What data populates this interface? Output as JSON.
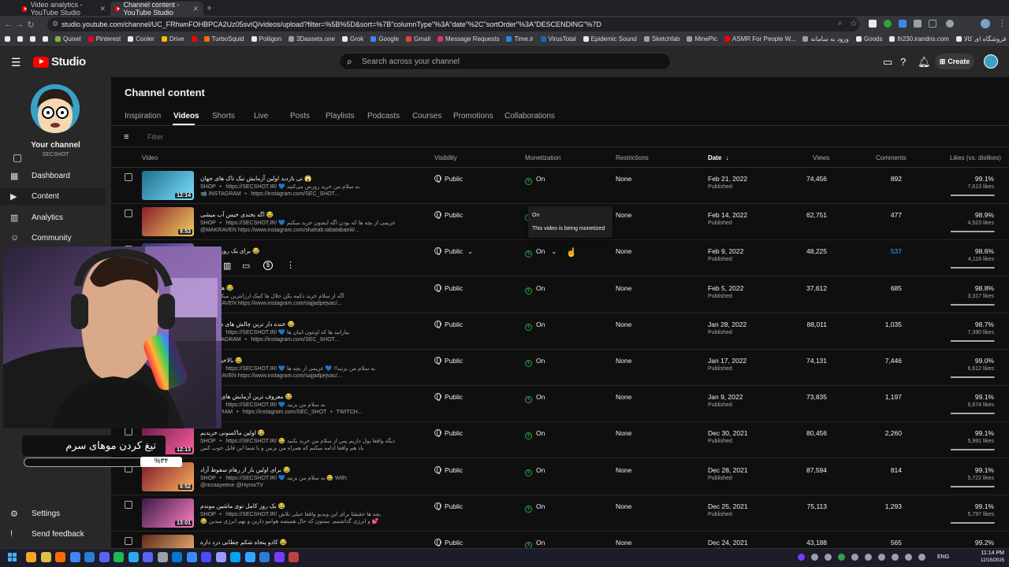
{
  "browser": {
    "tabs": [
      {
        "label": "Video analytics - YouTube Studio"
      },
      {
        "label": "Channel content - YouTube Studio"
      }
    ],
    "url": "studio.youtube.com/channel/UC_FRhwnFOHBPCA2Uz05svIQ/videos/upload?filter=%5B%5D&sort=%7B\"columnType\"%3A\"date\"%2C\"sortOrder\"%3A\"DESCENDING\"%7D",
    "bookmarks": [
      {
        "label": "",
        "color": "#e8eaed"
      },
      {
        "label": "",
        "color": "#e8eaed"
      },
      {
        "label": "",
        "color": "#e8eaed"
      },
      {
        "label": "",
        "color": "#e8eaed"
      },
      {
        "label": "Quixel",
        "color": "#7cb342"
      },
      {
        "label": "Pinterest",
        "color": "#e60023"
      },
      {
        "label": "Cooler",
        "color": "#e8eaed"
      },
      {
        "label": "Drive",
        "color": "#fbbc04"
      },
      {
        "label": "",
        "color": "#ff0000"
      },
      {
        "label": "TurboSquid",
        "color": "#ff6d00"
      },
      {
        "label": "Poliigon",
        "color": "#e8eaed"
      },
      {
        "label": "3Dassets.one",
        "color": "#9aa0a6"
      },
      {
        "label": "Grok",
        "color": "#e8eaed"
      },
      {
        "label": "Google",
        "color": "#4285f4"
      },
      {
        "label": "Gmail",
        "color": "#ea4335"
      },
      {
        "label": "Message Requests",
        "color": "#e1306c"
      },
      {
        "label": "Time.ir",
        "color": "#1e88e5"
      },
      {
        "label": "VirusTotal",
        "color": "#1565c0"
      },
      {
        "label": "Epidemic Sound",
        "color": "#e8eaed"
      },
      {
        "label": "Sketchfab",
        "color": "#9aa0a6"
      },
      {
        "label": "MinePic",
        "color": "#9aa0a6"
      },
      {
        "label": "ASMR For People W...",
        "color": "#ff0000"
      },
      {
        "label": "ورود به سامانه",
        "color": "#9aa0a6"
      },
      {
        "label": "Goods",
        "color": "#e8eaed"
      },
      {
        "label": "lh230.irandns.com",
        "color": "#e8eaed"
      },
      {
        "label": "فروشگاه ای کالا",
        "color": "#e8eaed"
      },
      {
        "label": "Other",
        "color": "#9aa0a6"
      },
      {
        "label": "All Bookmarks",
        "color": "#9aa0a6"
      }
    ]
  },
  "header": {
    "logo": "Studio",
    "search_placeholder": "Search across your channel",
    "create_label": "Create"
  },
  "sidebar": {
    "channel_title": "Your channel",
    "channel_name": "SECSHOT",
    "items": [
      {
        "label": "Dashboard",
        "icon": "dashboard-icon"
      },
      {
        "label": "Content",
        "icon": "content-icon"
      },
      {
        "label": "Analytics",
        "icon": "analytics-icon"
      },
      {
        "label": "Community",
        "icon": "community-icon"
      }
    ],
    "settings": "Settings",
    "feedback": "Send feedback"
  },
  "main": {
    "title": "Channel content",
    "tabs": [
      "Inspiration",
      "Videos",
      "Shorts",
      "Live",
      "Posts",
      "Playlists",
      "Podcasts",
      "Courses",
      "Promotions",
      "Collaborations"
    ],
    "filter_placeholder": "Filter",
    "columns": {
      "video": "Video",
      "visibility": "Visibility",
      "monetization": "Monetization",
      "restrictions": "Restrictions",
      "date": "Date",
      "views": "Views",
      "comments": "Comments",
      "likes": "Likes (vs. dislikes)"
    }
  },
  "tooltip": {
    "title": "On",
    "text": "This video is being monetized"
  },
  "rows": [
    {
      "title": "تی بازدید اولین آزمایش تیک تاک های جهان 😱",
      "desc1": "SHOP 🔹 https://SECSHOT.IR/ 💙 به سلام من خرید روزش می‌کنید",
      "desc2": "📹 INSTAGRAM 🔹 https://instagram.com/SEC_SHOT...",
      "duration": "12:14",
      "visibility": "Public",
      "monetization": "On",
      "restrictions": "None",
      "date": "Feb 21, 2022",
      "status": "Published",
      "views": "74,456",
      "comments": "892",
      "likes_pct": "99.1%",
      "likes": "7,613 likes",
      "ratio": 0.991
    },
    {
      "title": "اگه بخندی خیس آب میشی 😂",
      "desc1": "SHOP 🔹 https://SECSHOT.IR/ 💙 عزیمی از بچه ها که بودن اگه ایشون خرید میکنم",
      "desc2": "@MAKRAVEN https://www.instagram.com/shahab.tabatabaeiii/...",
      "duration": "9:53",
      "visibility": "Public",
      "monetization": "On",
      "restrictions": "None",
      "date": "Feb 14, 2022",
      "status": "Published",
      "views": "62,751",
      "comments": "477",
      "likes_pct": "98.9%",
      "likes": "4,523 likes",
      "ratio": 0.989
    },
    {
      "title": "برای یک روز کامل ها 😂",
      "desc1": "",
      "desc2": "",
      "duration": "",
      "visibility": "Public",
      "monetization": "On",
      "restrictions": "None",
      "date": "Feb 9, 2022",
      "status": "Published",
      "views": "48,225",
      "comments": "537",
      "likes_pct": "98.6%",
      "likes": "4,118 likes",
      "ratio": 0.986
    },
    {
      "title": "هدیه رو از 😂",
      "desc1": "اگه از سلام خرید دکمه بکن حلال ها کمک ارزانترین میکنم بچه ها",
      "desc2": "@MAKRAVEN https://www.instagram.com/sajjadpejvac/...",
      "duration": "",
      "visibility": "Public",
      "monetization": "On",
      "restrictions": "None",
      "date": "Feb 5, 2022",
      "status": "Published",
      "views": "37,612",
      "comments": "685",
      "likes_pct": "98.8%",
      "likes": "3,317 likes",
      "ratio": 0.988
    },
    {
      "title": "خنده دار ترین چالش های دنیای گال 😂",
      "desc1": "SHOP 🔹 https://SECSHOT.IR/ 💙 بیارانید ها که اونتون انیان ها",
      "desc2": "📹 INSTAGRAM 🔹 https://instagram.com/SEC_SHOT...",
      "duration": "",
      "visibility": "Public",
      "monetization": "On",
      "restrictions": "None",
      "date": "Jan 28, 2022",
      "status": "Published",
      "views": "88,011",
      "comments": "1,035",
      "likes_pct": "98.7%",
      "likes": "7,390 likes",
      "ratio": 0.987
    },
    {
      "title": "بالاخره موهام 😂",
      "desc1": "SHOP 🔹 https://SECSHOT.IR/ 💙 به سلام من بزنید!! 💙 عزیمی از بچه ها",
      "desc2": "@MAKRAVEN https://www.instagram.com/sajjadpejvac/...",
      "duration": "",
      "visibility": "Public",
      "monetization": "On",
      "restrictions": "None",
      "date": "Jan 17, 2022",
      "status": "Published",
      "views": "74,131",
      "comments": "7,446",
      "likes_pct": "99.0%",
      "likes": "6,612 likes",
      "ratio": 0.99
    },
    {
      "title": "معروف ترین آزمایش های تیک تاک 😂",
      "desc1": "SHOP 🔹 https://SECSHOT.IR/ 💙 به سلام من بزنید",
      "desc2": "INSTAGRAM 🔹 https://instagram.com/SEC_SHOT 🔹 TWITCH...",
      "duration": "",
      "visibility": "Public",
      "monetization": "On",
      "restrictions": "None",
      "date": "Jan 9, 2022",
      "status": "Published",
      "views": "73,835",
      "comments": "1,197",
      "likes_pct": "99.1%",
      "likes": "6,674 likes",
      "ratio": 0.991
    },
    {
      "title": "اولین ماکسونی خریدیم 😂",
      "desc1": "SHOP 🔹 https://SECSHOT.IR/ 😂 دیگه واقعا پول داریم پس از سلام من خرید بکنید",
      "desc2": "یاد هم واقعا ادامه میکنم که همراه من بزنین و با شما این قابل خوب کنین",
      "duration": "12:13",
      "visibility": "Public",
      "monetization": "On",
      "restrictions": "None",
      "date": "Dec 30, 2021",
      "status": "Published",
      "views": "80,456",
      "comments": "2,260",
      "likes_pct": "99.1%",
      "likes": "5,991 likes",
      "ratio": 0.991
    },
    {
      "title": "برای اولین بار از رهام سقوط آزاد 😂",
      "desc1": "SHOP 🔹 https://SECSHOT.IR/ 💙 به سلام من بزنید 😂 With:",
      "desc2": "@rezaayeene @HyroxTV",
      "duration": "8:52",
      "visibility": "Public",
      "monetization": "On",
      "restrictions": "None",
      "date": "Dec 28, 2021",
      "status": "Published",
      "views": "87,594",
      "comments": "814",
      "likes_pct": "99.1%",
      "likes": "5,722 likes",
      "ratio": 0.991
    },
    {
      "title": "یک روز کامل توی ماشین موندم 😂",
      "desc1": "SHOP 🔹 https://SECSHOT.IR/ بچه ها حقیقتا برای این ویدیو واقعا خیلی تلاش",
      "desc2": "😂 و انرژی گذاشتیم. ممنون که حال همیشه هوامو دارین و بهم انرژی میدین 💕",
      "duration": "13:01",
      "visibility": "Public",
      "monetization": "On",
      "restrictions": "None",
      "date": "Dec 25, 2021",
      "status": "Published",
      "views": "75,113",
      "comments": "1,293",
      "likes_pct": "99.1%",
      "likes": "5,797 likes",
      "ratio": 0.991
    },
    {
      "title": "کادو پنجاه شکم چطابی درد داره 😂",
      "desc1": "",
      "desc2": "",
      "duration": "",
      "visibility": "Public",
      "monetization": "On",
      "restrictions": "None",
      "date": "Dec 24, 2021",
      "status": "Published",
      "views": "43,188",
      "comments": "565",
      "likes_pct": "99.2%",
      "likes": "",
      "ratio": 0.992
    }
  ],
  "overlay": {
    "title": "تیغ کردن موهای سرم",
    "percent": "%۳۴"
  },
  "taskbar": {
    "lang": "ENG",
    "time": "11:14 PM",
    "date": "12/15/2025"
  }
}
